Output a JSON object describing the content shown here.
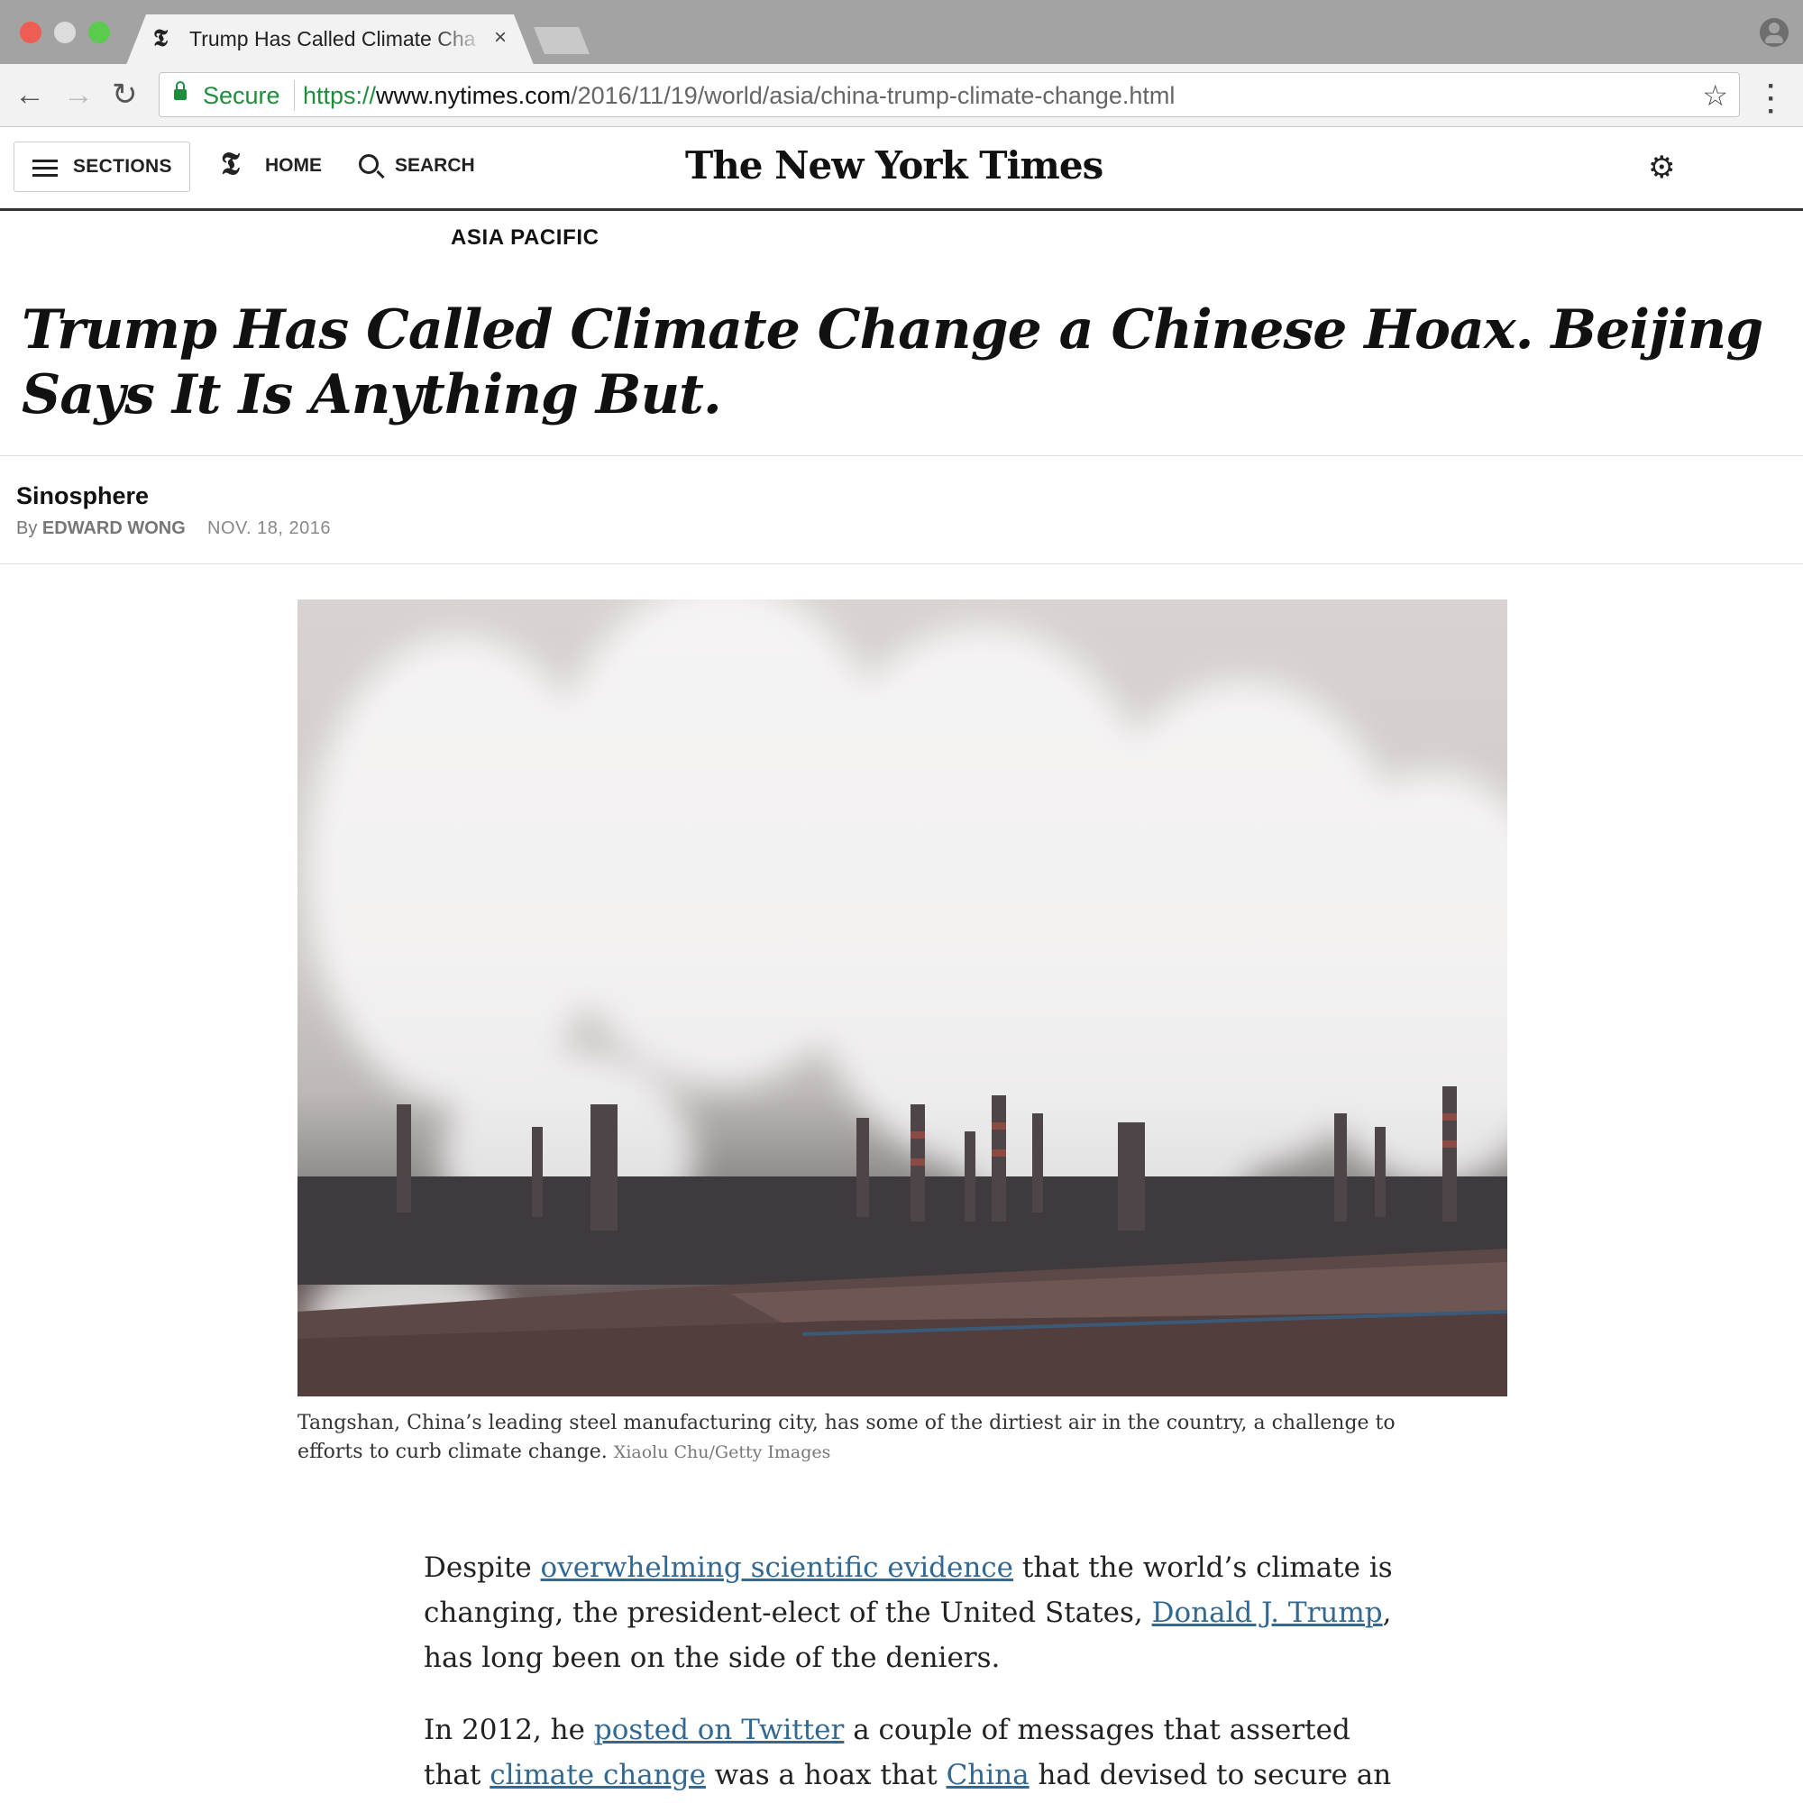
{
  "browser": {
    "tab_title": "Trump Has Called Climate Cha",
    "tab_close": "×",
    "secure_label": "Secure",
    "url_protocol": "https://",
    "url_host": "www.nytimes.com",
    "url_path": "/2016/11/19/world/asia/china-trump-climate-change.html",
    "icons": [
      "back-arrow-icon",
      "forward-arrow-icon",
      "reload-icon",
      "lock-icon",
      "star-icon",
      "menu-dots-icon",
      "profile-icon"
    ]
  },
  "masthead": {
    "sections_label": "SECTIONS",
    "home_label": "HOME",
    "search_label": "SEARCH",
    "logo": "The New York Times",
    "t_glyph": "𝕿"
  },
  "article": {
    "kicker": "ASIA PACIFIC",
    "headline": "Trump Has Called Climate Change a Chinese Hoax. Beijing Says It Is Anything But.",
    "blog": "Sinosphere",
    "byline_prefix": "By ",
    "author": "EDWARD WONG",
    "date": "NOV. 18, 2016",
    "photo_caption": "Tangshan, China’s leading steel manufacturing city, has some of the dirtiest air in the country, a challenge to efforts to curb climate change.",
    "photo_credit": "Xiaolu Chu/Getty Images",
    "p1": {
      "t1": "Despite ",
      "link1": "overwhelming scientific evidence",
      "t2": " that the world’s climate is changing, the president-elect of the United States, ",
      "link2": "Donald J. Trump",
      "t3": ", has long been on the side of the deniers."
    },
    "p2": {
      "t1": "In 2012, he ",
      "link1": "posted on Twitter",
      "t2": " a couple of messages that asserted that ",
      "link2": "climate change",
      "t3": " was a hoax that ",
      "link3": "China",
      "t4": " had devised to secure an unfair trade"
    }
  },
  "colors": {
    "link": "#326891",
    "secure_green": "#1e8e3e",
    "tabbar": "#a3a3a3"
  }
}
